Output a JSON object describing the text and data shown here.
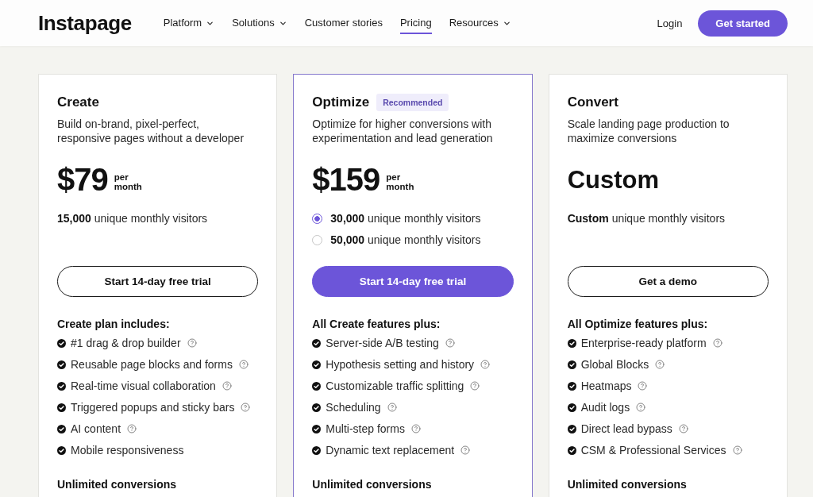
{
  "header": {
    "logo": "Instapage",
    "nav": [
      {
        "label": "Platform",
        "has_menu": true,
        "selected": false
      },
      {
        "label": "Solutions",
        "has_menu": true,
        "selected": false
      },
      {
        "label": "Customer stories",
        "has_menu": false,
        "selected": false
      },
      {
        "label": "Pricing",
        "has_menu": false,
        "selected": true
      },
      {
        "label": "Resources",
        "has_menu": true,
        "selected": false
      }
    ],
    "login": "Login",
    "cta": "Get started"
  },
  "plans": [
    {
      "name": "Create",
      "featured": false,
      "description": "Build on-brand, pixel-perfect, responsive pages without a developer",
      "price": {
        "amount": "$79",
        "period": "per month"
      },
      "visitors": [
        {
          "kind": "plain",
          "text": "**15,000** unique monthly visitors"
        }
      ],
      "button": "Start 14-day free trial",
      "features_heading": "Create plan includes:",
      "features": [
        {
          "text": "#1 drag & drop builder",
          "info": true
        },
        {
          "text": "Reusable page blocks and forms",
          "info": true
        },
        {
          "text": "Real-time visual collaboration",
          "info": true
        },
        {
          "text": "Triggered popups and sticky bars",
          "info": true
        },
        {
          "text": "AI content",
          "info": true
        },
        {
          "text": "Mobile responsiveness",
          "info": false
        }
      ],
      "footer": "Unlimited conversions"
    },
    {
      "name": "Optimize",
      "badge": "Recommended",
      "featured": true,
      "description": "Optimize for higher conversions with experimentation and lead generation",
      "price": {
        "amount": "$159",
        "period": "per month"
      },
      "visitors": [
        {
          "kind": "radio",
          "selected": true,
          "text": "**30,000** unique monthly visitors"
        },
        {
          "kind": "radio",
          "selected": false,
          "text": "**50,000** unique monthly visitors"
        }
      ],
      "button": "Start 14-day free trial",
      "features_heading": "All Create features plus:",
      "features": [
        {
          "text": "Server-side A/B testing",
          "info": true
        },
        {
          "text": "Hypothesis setting and history",
          "info": true
        },
        {
          "text": "Customizable traffic splitting",
          "info": true
        },
        {
          "text": "Scheduling",
          "info": true
        },
        {
          "text": "Multi-step forms",
          "info": true
        },
        {
          "text": "Dynamic text replacement",
          "info": true
        }
      ],
      "footer": "Unlimited conversions"
    },
    {
      "name": "Convert",
      "featured": false,
      "description": "Scale landing page production to maximize conversions",
      "price": {
        "amount": "Custom"
      },
      "visitors": [
        {
          "kind": "plain",
          "text": "**Custom** unique monthly visitors"
        }
      ],
      "button": "Get a demo",
      "features_heading": "All Optimize features plus:",
      "features": [
        {
          "text": "Enterprise-ready platform",
          "info": true
        },
        {
          "text": "Global Blocks",
          "info": true
        },
        {
          "text": "Heatmaps",
          "info": true
        },
        {
          "text": "Audit logs",
          "info": true
        },
        {
          "text": "Direct lead bypass",
          "info": true
        },
        {
          "text": "CSM & Professional Services",
          "info": true
        }
      ],
      "footer": "Unlimited conversions"
    }
  ]
}
